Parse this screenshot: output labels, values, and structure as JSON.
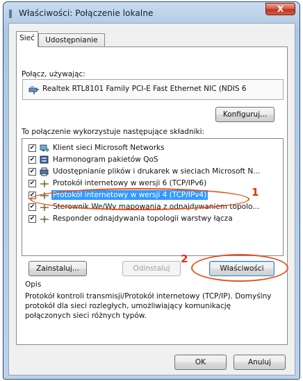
{
  "window": {
    "title": "Właściwości: Połączenie lokalne",
    "close_label": "X"
  },
  "tabs": [
    {
      "label": "Sieć",
      "active": true
    },
    {
      "label": "Udostępnianie",
      "active": false
    }
  ],
  "connect_using": {
    "label": "Połącz, używając:",
    "adapter": "Realtek RTL8101 Family PCI-E Fast Ethernet NIC (NDIS 6",
    "configure_button": "Konfiguruj..."
  },
  "components": {
    "label": "To połączenie wykorzystuje następujące składniki:",
    "items": [
      {
        "label": "Klient sieci Microsoft Networks",
        "checked": true,
        "icon": "network-client-icon",
        "selected": false
      },
      {
        "label": "Harmonogram pakietów QoS",
        "checked": true,
        "icon": "qos-scheduler-icon",
        "selected": false
      },
      {
        "label": "Udostępnianie plików i drukarek w sieciach Microsoft N...",
        "checked": true,
        "icon": "file-printer-sharing-icon",
        "selected": false
      },
      {
        "label": "Protokół internetowy w wersji 6 (TCP/IPv6)",
        "checked": true,
        "icon": "protocol-icon",
        "selected": false
      },
      {
        "label": "Protokół internetowy w wersji 4 (TCP/IPv4)",
        "checked": true,
        "icon": "protocol-icon",
        "selected": true
      },
      {
        "label": "Sterownik We/Wy mapowania z odnajdywaniem topolo...",
        "checked": true,
        "icon": "protocol-icon",
        "selected": false
      },
      {
        "label": "Responder odnajdywania topologii warstwy łącza",
        "checked": true,
        "icon": "protocol-icon",
        "selected": false
      }
    ]
  },
  "buttons": {
    "install": "Zainstaluj...",
    "uninstall": "Odinstaluj",
    "properties": "Właściwości",
    "ok": "OK",
    "cancel": "Anuluj"
  },
  "description": {
    "title": "Opis",
    "text": "Protokół kontroli transmisji/Protokół internetowy (TCP/IP). Domyślny protokół dla sieci rozległych, umożliwiający komunikację połączonych sieci różnych typów."
  },
  "annotations": [
    {
      "number": "1"
    },
    {
      "number": "2"
    }
  ],
  "colors": {
    "selection": "#3399ff",
    "annotation": "#e8501c",
    "close_button": "#c1321c"
  }
}
